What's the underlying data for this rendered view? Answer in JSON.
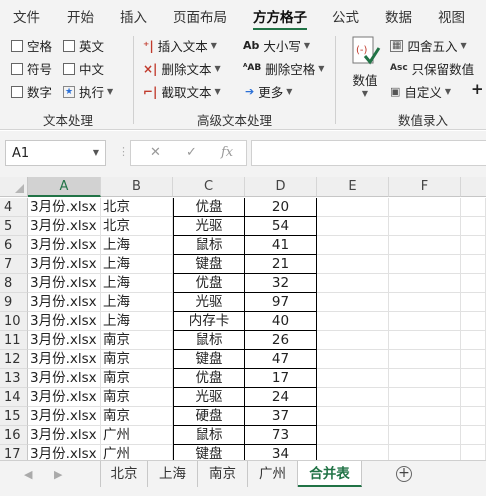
{
  "menu": {
    "tabs": [
      "文件",
      "开始",
      "插入",
      "页面布局",
      "方方格子",
      "公式",
      "数据",
      "视图"
    ],
    "active": "方方格子"
  },
  "ribbon": {
    "text_group": {
      "label": "文本处理",
      "checkboxes": [
        "空格",
        "英文",
        "符号",
        "中文",
        "数字"
      ],
      "execute": "执行"
    },
    "advanced_group": {
      "label": "高级文本处理",
      "insert_text": "插入文本",
      "delete_text": "删除文本",
      "extract_text": "截取文本",
      "case": "大小写",
      "delete_spaces": "删除空格",
      "more": "更多"
    },
    "number_group": {
      "label": "数值录入",
      "value_button": "数值",
      "round": "四舍五入",
      "keep_value": "只保留数值",
      "custom": "自定义"
    }
  },
  "formula_bar": {
    "name_box": "A1",
    "fx": "fx",
    "cancel": "✕",
    "confirm": "✓",
    "formula": ""
  },
  "grid": {
    "columns": [
      "A",
      "B",
      "C",
      "D",
      "E",
      "F"
    ],
    "selected_column": "A",
    "rows": [
      {
        "n": "4",
        "a": "3月份.xlsx",
        "b": "北京",
        "c": "优盘",
        "d": "20"
      },
      {
        "n": "5",
        "a": "3月份.xlsx",
        "b": "北京",
        "c": "光驱",
        "d": "54"
      },
      {
        "n": "6",
        "a": "3月份.xlsx",
        "b": "上海",
        "c": "鼠标",
        "d": "41"
      },
      {
        "n": "7",
        "a": "3月份.xlsx",
        "b": "上海",
        "c": "键盘",
        "d": "21"
      },
      {
        "n": "8",
        "a": "3月份.xlsx",
        "b": "上海",
        "c": "优盘",
        "d": "32"
      },
      {
        "n": "9",
        "a": "3月份.xlsx",
        "b": "上海",
        "c": "光驱",
        "d": "97"
      },
      {
        "n": "10",
        "a": "3月份.xlsx",
        "b": "上海",
        "c": "内存卡",
        "d": "40"
      },
      {
        "n": "11",
        "a": "3月份.xlsx",
        "b": "南京",
        "c": "鼠标",
        "d": "26"
      },
      {
        "n": "12",
        "a": "3月份.xlsx",
        "b": "南京",
        "c": "键盘",
        "d": "47"
      },
      {
        "n": "13",
        "a": "3月份.xlsx",
        "b": "南京",
        "c": "优盘",
        "d": "17"
      },
      {
        "n": "14",
        "a": "3月份.xlsx",
        "b": "南京",
        "c": "光驱",
        "d": "24"
      },
      {
        "n": "15",
        "a": "3月份.xlsx",
        "b": "南京",
        "c": "硬盘",
        "d": "37"
      },
      {
        "n": "16",
        "a": "3月份.xlsx",
        "b": "广州",
        "c": "鼠标",
        "d": "73"
      },
      {
        "n": "17",
        "a": "3月份.xlsx",
        "b": "广州",
        "c": "键盘",
        "d": "34"
      }
    ]
  },
  "sheets": {
    "tabs": [
      "北京",
      "上海",
      "南京",
      "广州",
      "合并表"
    ],
    "active": "合并表"
  },
  "colors": {
    "accent": "#217346",
    "ribbon_bg": "#f3f3f3"
  }
}
